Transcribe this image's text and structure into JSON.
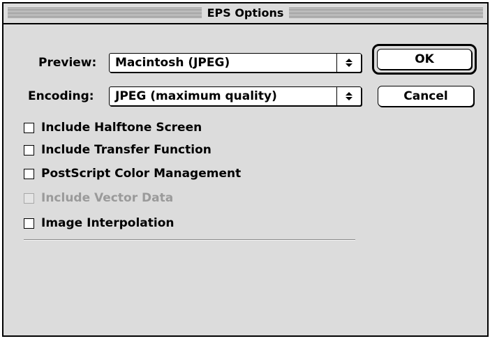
{
  "window": {
    "title": "EPS Options"
  },
  "preview": {
    "label": "Preview:",
    "value": "Macintosh  (JPEG)"
  },
  "encoding": {
    "label": "Encoding:",
    "value": "JPEG  (maximum quality)"
  },
  "buttons": {
    "ok": "OK",
    "cancel": "Cancel"
  },
  "checkboxes": [
    {
      "label": "Include Halftone Screen",
      "checked": false,
      "enabled": true
    },
    {
      "label": "Include Transfer Function",
      "checked": false,
      "enabled": true
    },
    {
      "label": "PostScript Color Management",
      "checked": false,
      "enabled": true
    },
    {
      "label": "Include Vector Data",
      "checked": false,
      "enabled": false
    },
    {
      "label": "Image Interpolation",
      "checked": false,
      "enabled": true
    }
  ],
  "colors": {
    "dialog_background": "#dcdcdc",
    "disabled_text": "#9a9a9a"
  },
  "icons": {
    "popup_arrows": "up-down-arrows-icon"
  }
}
